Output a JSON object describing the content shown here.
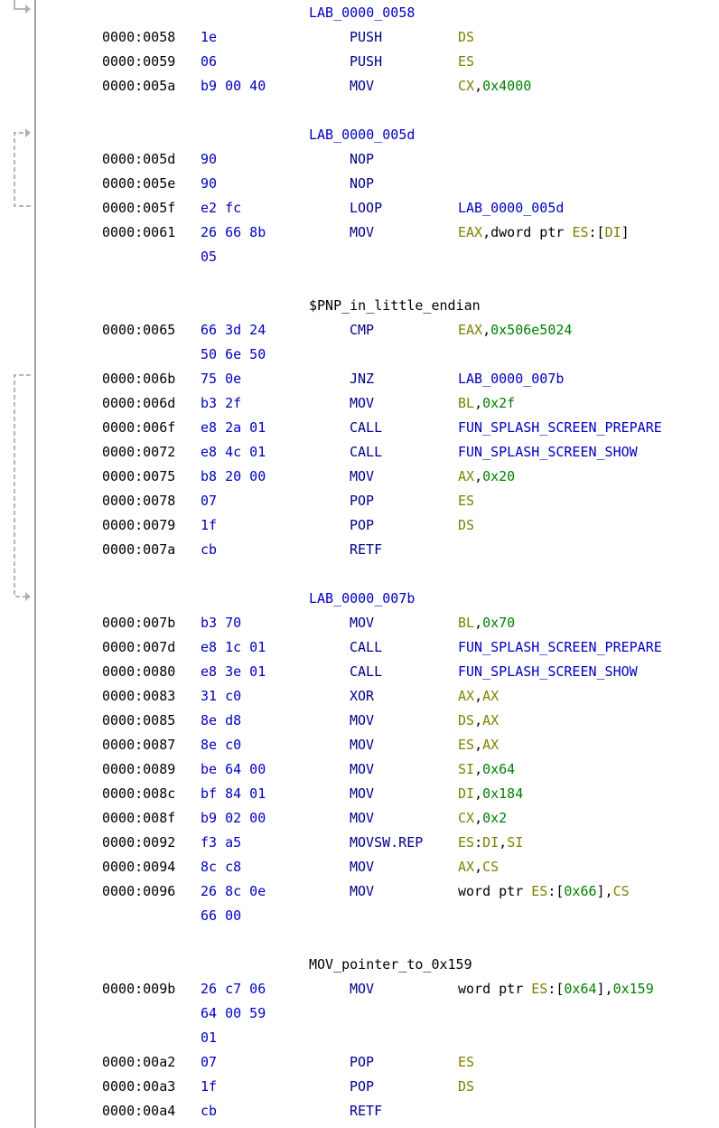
{
  "colors": {
    "address": "#000000",
    "bytes": "#0000c0",
    "mnemonic": "#00008b",
    "register": "#808000",
    "scalar": "#008000",
    "reference": "#0000c0",
    "flow_arrow": "#a0a0a0"
  },
  "listing": [
    {
      "label": "LAB_0000_0058",
      "kind": "label"
    },
    {
      "addr": "0000:0058",
      "bytes": "1e",
      "mn": "PUSH",
      "op": [
        {
          "t": "DS",
          "c": "reg"
        }
      ]
    },
    {
      "addr": "0000:0059",
      "bytes": "06",
      "mn": "PUSH",
      "op": [
        {
          "t": "ES",
          "c": "reg"
        }
      ]
    },
    {
      "addr": "0000:005a",
      "bytes": "b9 00 40",
      "mn": "MOV",
      "op": [
        {
          "t": "CX",
          "c": "reg"
        },
        {
          "t": ",",
          "c": "txt"
        },
        {
          "t": "0x4000",
          "c": "num"
        }
      ]
    },
    {
      "blank": true
    },
    {
      "label": "LAB_0000_005d",
      "kind": "label"
    },
    {
      "addr": "0000:005d",
      "bytes": "90",
      "mn": "NOP",
      "op": []
    },
    {
      "addr": "0000:005e",
      "bytes": "90",
      "mn": "NOP",
      "op": []
    },
    {
      "addr": "0000:005f",
      "bytes": "e2 fc",
      "mn": "LOOP",
      "op": [
        {
          "t": "LAB_0000_005d",
          "c": "ref"
        }
      ]
    },
    {
      "addr": "0000:0061",
      "bytes": "26 66 8b",
      "mn": "MOV",
      "op": [
        {
          "t": "EAX",
          "c": "reg"
        },
        {
          "t": ",dword ptr ",
          "c": "txt"
        },
        {
          "t": "ES",
          "c": "reg"
        },
        {
          "t": ":[",
          "c": "txt"
        },
        {
          "t": "DI",
          "c": "reg"
        },
        {
          "t": "]",
          "c": "txt"
        }
      ]
    },
    {
      "bytes": "05"
    },
    {
      "blank": true
    },
    {
      "label": "$PNP_in_little_endian",
      "kind": "comment"
    },
    {
      "addr": "0000:0065",
      "bytes": "66 3d 24",
      "mn": "CMP",
      "op": [
        {
          "t": "EAX",
          "c": "reg"
        },
        {
          "t": ",",
          "c": "txt"
        },
        {
          "t": "0x506e5024",
          "c": "num"
        }
      ]
    },
    {
      "bytes": "50 6e 50"
    },
    {
      "addr": "0000:006b",
      "bytes": "75 0e",
      "mn": "JNZ",
      "op": [
        {
          "t": "LAB_0000_007b",
          "c": "ref"
        }
      ]
    },
    {
      "addr": "0000:006d",
      "bytes": "b3 2f",
      "mn": "MOV",
      "op": [
        {
          "t": "BL",
          "c": "reg"
        },
        {
          "t": ",",
          "c": "txt"
        },
        {
          "t": "0x2f",
          "c": "num"
        }
      ]
    },
    {
      "addr": "0000:006f",
      "bytes": "e8 2a 01",
      "mn": "CALL",
      "op": [
        {
          "t": "FUN_SPLASH_SCREEN_PREPARE",
          "c": "ref"
        }
      ]
    },
    {
      "addr": "0000:0072",
      "bytes": "e8 4c 01",
      "mn": "CALL",
      "op": [
        {
          "t": "FUN_SPLASH_SCREEN_SHOW",
          "c": "ref"
        }
      ]
    },
    {
      "addr": "0000:0075",
      "bytes": "b8 20 00",
      "mn": "MOV",
      "op": [
        {
          "t": "AX",
          "c": "reg"
        },
        {
          "t": ",",
          "c": "txt"
        },
        {
          "t": "0x20",
          "c": "num"
        }
      ]
    },
    {
      "addr": "0000:0078",
      "bytes": "07",
      "mn": "POP",
      "op": [
        {
          "t": "ES",
          "c": "reg"
        }
      ]
    },
    {
      "addr": "0000:0079",
      "bytes": "1f",
      "mn": "POP",
      "op": [
        {
          "t": "DS",
          "c": "reg"
        }
      ]
    },
    {
      "addr": "0000:007a",
      "bytes": "cb",
      "mn": "RETF",
      "op": []
    },
    {
      "blank": true
    },
    {
      "label": "LAB_0000_007b",
      "kind": "label"
    },
    {
      "addr": "0000:007b",
      "bytes": "b3 70",
      "mn": "MOV",
      "op": [
        {
          "t": "BL",
          "c": "reg"
        },
        {
          "t": ",",
          "c": "txt"
        },
        {
          "t": "0x70",
          "c": "num"
        }
      ]
    },
    {
      "addr": "0000:007d",
      "bytes": "e8 1c 01",
      "mn": "CALL",
      "op": [
        {
          "t": "FUN_SPLASH_SCREEN_PREPARE",
          "c": "ref"
        }
      ]
    },
    {
      "addr": "0000:0080",
      "bytes": "e8 3e 01",
      "mn": "CALL",
      "op": [
        {
          "t": "FUN_SPLASH_SCREEN_SHOW",
          "c": "ref"
        }
      ]
    },
    {
      "addr": "0000:0083",
      "bytes": "31 c0",
      "mn": "XOR",
      "op": [
        {
          "t": "AX",
          "c": "reg"
        },
        {
          "t": ",",
          "c": "txt"
        },
        {
          "t": "AX",
          "c": "reg"
        }
      ]
    },
    {
      "addr": "0000:0085",
      "bytes": "8e d8",
      "mn": "MOV",
      "op": [
        {
          "t": "DS",
          "c": "reg"
        },
        {
          "t": ",",
          "c": "txt"
        },
        {
          "t": "AX",
          "c": "reg"
        }
      ]
    },
    {
      "addr": "0000:0087",
      "bytes": "8e c0",
      "mn": "MOV",
      "op": [
        {
          "t": "ES",
          "c": "reg"
        },
        {
          "t": ",",
          "c": "txt"
        },
        {
          "t": "AX",
          "c": "reg"
        }
      ]
    },
    {
      "addr": "0000:0089",
      "bytes": "be 64 00",
      "mn": "MOV",
      "op": [
        {
          "t": "SI",
          "c": "reg"
        },
        {
          "t": ",",
          "c": "txt"
        },
        {
          "t": "0x64",
          "c": "num"
        }
      ]
    },
    {
      "addr": "0000:008c",
      "bytes": "bf 84 01",
      "mn": "MOV",
      "op": [
        {
          "t": "DI",
          "c": "reg"
        },
        {
          "t": ",",
          "c": "txt"
        },
        {
          "t": "0x184",
          "c": "num"
        }
      ]
    },
    {
      "addr": "0000:008f",
      "bytes": "b9 02 00",
      "mn": "MOV",
      "op": [
        {
          "t": "CX",
          "c": "reg"
        },
        {
          "t": ",",
          "c": "txt"
        },
        {
          "t": "0x2",
          "c": "num"
        }
      ]
    },
    {
      "addr": "0000:0092",
      "bytes": "f3 a5",
      "mn": "MOVSW.REP",
      "op": [
        {
          "t": "ES",
          "c": "reg"
        },
        {
          "t": ":",
          "c": "txt"
        },
        {
          "t": "DI",
          "c": "reg"
        },
        {
          "t": ",",
          "c": "txt"
        },
        {
          "t": "SI",
          "c": "reg"
        }
      ]
    },
    {
      "addr": "0000:0094",
      "bytes": "8c c8",
      "mn": "MOV",
      "op": [
        {
          "t": "AX",
          "c": "reg"
        },
        {
          "t": ",",
          "c": "txt"
        },
        {
          "t": "CS",
          "c": "reg"
        }
      ]
    },
    {
      "addr": "0000:0096",
      "bytes": "26 8c 0e",
      "mn": "MOV",
      "op": [
        {
          "t": "word ptr ",
          "c": "txt"
        },
        {
          "t": "ES",
          "c": "reg"
        },
        {
          "t": ":[",
          "c": "txt"
        },
        {
          "t": "0x66",
          "c": "num"
        },
        {
          "t": "],",
          "c": "txt"
        },
        {
          "t": "CS",
          "c": "reg"
        }
      ]
    },
    {
      "bytes": "66 00"
    },
    {
      "blank": true
    },
    {
      "label": "MOV_pointer_to_0x159",
      "kind": "comment"
    },
    {
      "addr": "0000:009b",
      "bytes": "26 c7 06",
      "mn": "MOV",
      "op": [
        {
          "t": "word ptr ",
          "c": "txt"
        },
        {
          "t": "ES",
          "c": "reg"
        },
        {
          "t": ":[",
          "c": "txt"
        },
        {
          "t": "0x64",
          "c": "num"
        },
        {
          "t": "],",
          "c": "txt"
        },
        {
          "t": "0x159",
          "c": "num"
        }
      ]
    },
    {
      "bytes": "64 00 59"
    },
    {
      "bytes": "01"
    },
    {
      "addr": "0000:00a2",
      "bytes": "07",
      "mn": "POP",
      "op": [
        {
          "t": "ES",
          "c": "reg"
        }
      ]
    },
    {
      "addr": "0000:00a3",
      "bytes": "1f",
      "mn": "POP",
      "op": [
        {
          "t": "DS",
          "c": "reg"
        }
      ]
    },
    {
      "addr": "0000:00a4",
      "bytes": "cb",
      "mn": "RETF",
      "op": []
    }
  ]
}
